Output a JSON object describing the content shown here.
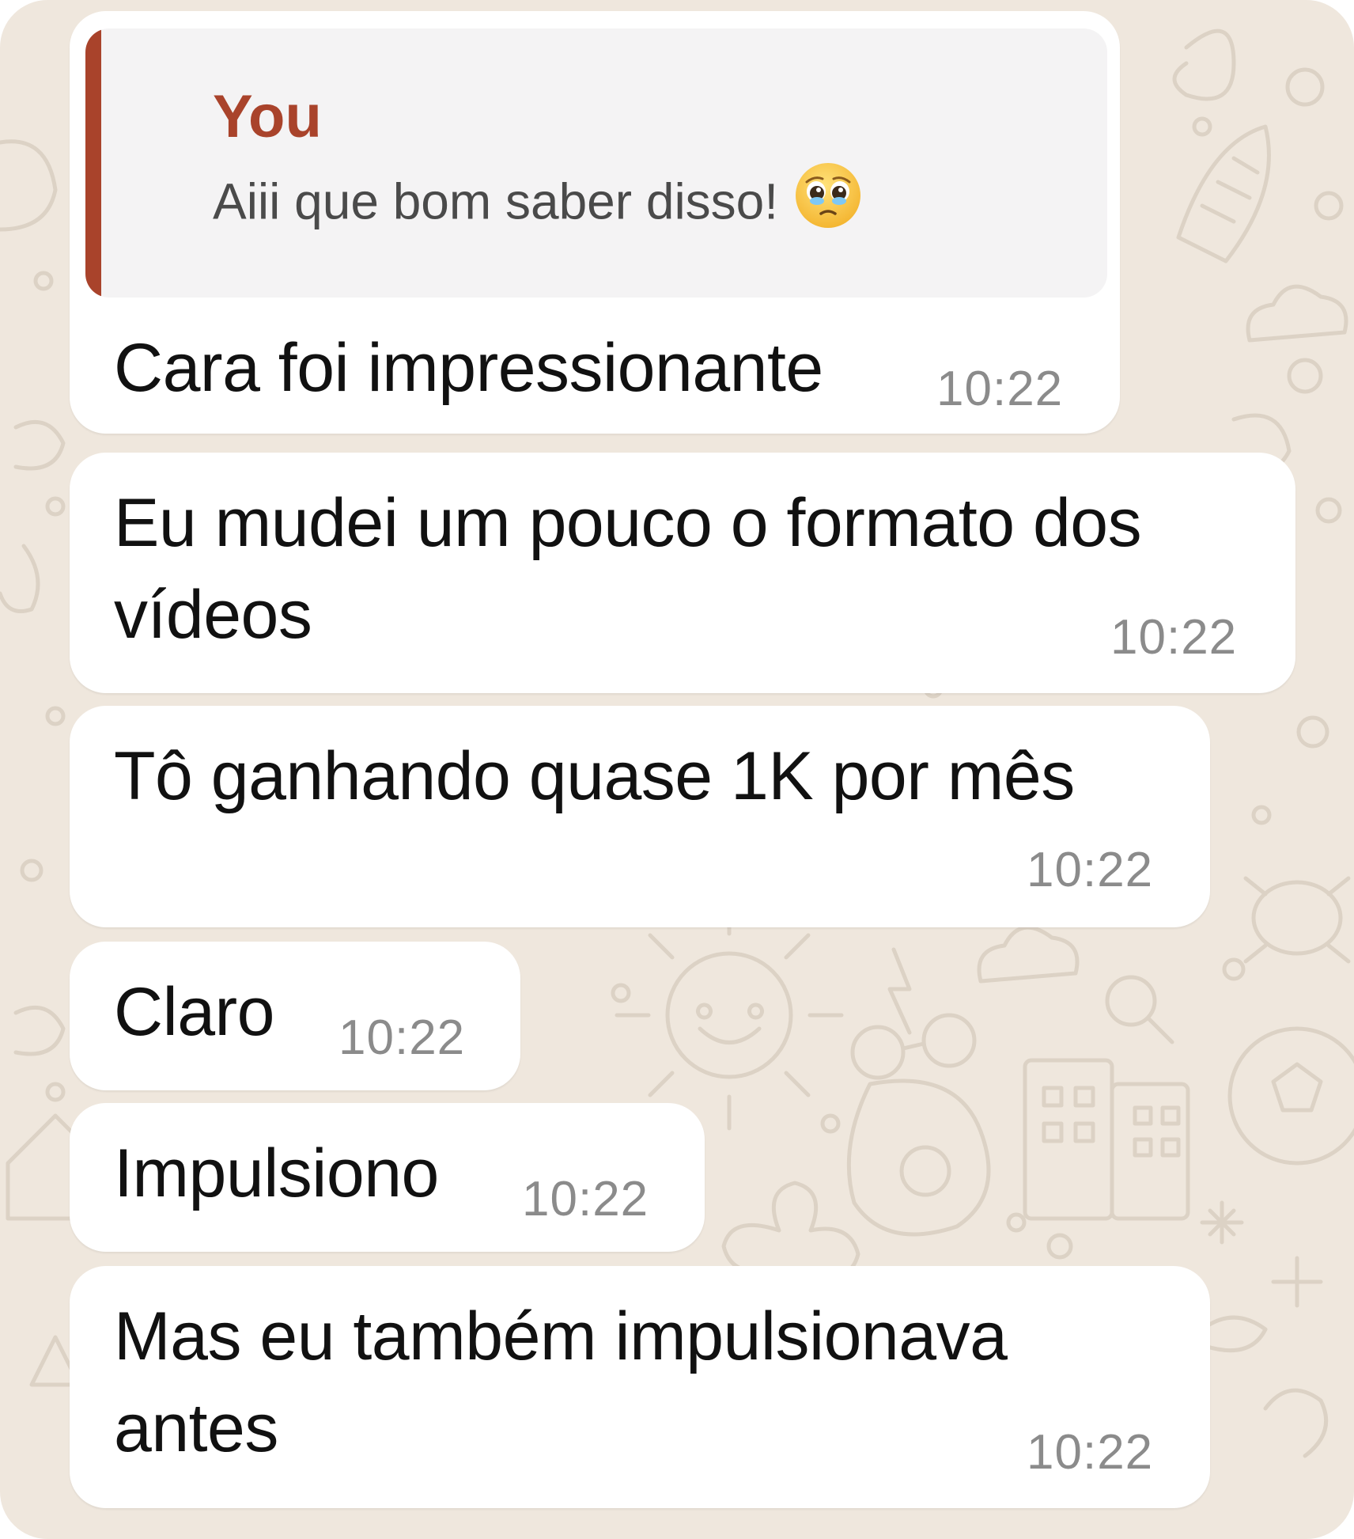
{
  "colors": {
    "background": "#efe7dd",
    "bubble": "#ffffff",
    "quote_accent": "#a9432b",
    "quote_background": "#f4f3f4",
    "timestamp": "#8b8b8b",
    "text": "#111111"
  },
  "quoted_reply": {
    "author": "You",
    "text": "Aiii que bom saber disso!",
    "emoji": "pleading-face-icon"
  },
  "messages": [
    {
      "lines": [
        "Cara foi impressionante"
      ],
      "time": "10:22"
    },
    {
      "lines": [
        "Eu mudei um pouco o formato dos",
        "vídeos"
      ],
      "time": "10:22"
    },
    {
      "lines": [
        "Tô ganhando quase 1K por mês"
      ],
      "time": "10:22"
    },
    {
      "lines": [
        "Claro"
      ],
      "time": "10:22"
    },
    {
      "lines": [
        "Impulsiono"
      ],
      "time": "10:22"
    },
    {
      "lines": [
        "Mas eu também impulsionava",
        "antes"
      ],
      "time": "10:22"
    }
  ]
}
